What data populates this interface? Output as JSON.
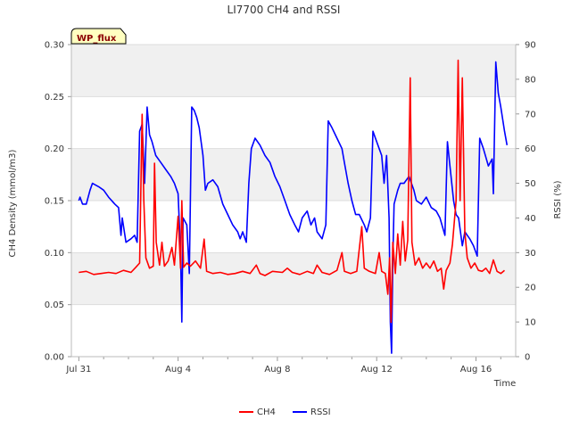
{
  "chart_data": {
    "type": "line",
    "title": "LI7700 CH4 and RSSI",
    "badge": "WP_flux",
    "xlabel": "Time",
    "ylabel_left": "CH4 Density (mmol/m3)",
    "ylabel_right": "RSSI (%)",
    "x_unit": "days since Jul 31",
    "xlim": [
      -0.3,
      17.6
    ],
    "ylim_left": [
      0,
      0.3
    ],
    "ylim_right": [
      0,
      90
    ],
    "x_ticks": [
      {
        "value": 0,
        "label": "Jul 31"
      },
      {
        "value": 4,
        "label": "Aug 4"
      },
      {
        "value": 8,
        "label": "Aug 8"
      },
      {
        "value": 12,
        "label": "Aug 12"
      },
      {
        "value": 16,
        "label": "Aug 16"
      }
    ],
    "y_left_ticks": [
      "0.00",
      "0.05",
      "0.10",
      "0.15",
      "0.20",
      "0.25",
      "0.30"
    ],
    "y_right_ticks": [
      "0",
      "10",
      "20",
      "30",
      "40",
      "50",
      "60",
      "70",
      "80",
      "90"
    ],
    "shaded_bands_left": [
      [
        0.05,
        0.1
      ],
      [
        0.15,
        0.2
      ],
      [
        0.25,
        0.3
      ]
    ],
    "grid": true,
    "legend_position": "bottom",
    "series": [
      {
        "name": "CH4",
        "axis": "left",
        "color": "#ff0000",
        "points": [
          [
            0.0,
            0.081
          ],
          [
            0.3,
            0.082
          ],
          [
            0.6,
            0.079
          ],
          [
            0.9,
            0.08
          ],
          [
            1.2,
            0.081
          ],
          [
            1.5,
            0.08
          ],
          [
            1.8,
            0.083
          ],
          [
            2.1,
            0.081
          ],
          [
            2.3,
            0.086
          ],
          [
            2.45,
            0.09
          ],
          [
            2.55,
            0.233
          ],
          [
            2.62,
            0.15
          ],
          [
            2.7,
            0.095
          ],
          [
            2.85,
            0.085
          ],
          [
            3.0,
            0.087
          ],
          [
            3.05,
            0.186
          ],
          [
            3.12,
            0.11
          ],
          [
            3.25,
            0.088
          ],
          [
            3.35,
            0.11
          ],
          [
            3.45,
            0.087
          ],
          [
            3.6,
            0.092
          ],
          [
            3.75,
            0.105
          ],
          [
            3.85,
            0.088
          ],
          [
            4.0,
            0.135
          ],
          [
            4.1,
            0.085
          ],
          [
            4.15,
            0.15
          ],
          [
            4.22,
            0.086
          ],
          [
            4.35,
            0.09
          ],
          [
            4.5,
            0.087
          ],
          [
            4.7,
            0.092
          ],
          [
            4.9,
            0.085
          ],
          [
            5.05,
            0.113
          ],
          [
            5.15,
            0.082
          ],
          [
            5.4,
            0.08
          ],
          [
            5.7,
            0.081
          ],
          [
            6.0,
            0.079
          ],
          [
            6.3,
            0.08
          ],
          [
            6.6,
            0.082
          ],
          [
            6.9,
            0.08
          ],
          [
            7.15,
            0.088
          ],
          [
            7.3,
            0.08
          ],
          [
            7.5,
            0.078
          ],
          [
            7.8,
            0.082
          ],
          [
            8.2,
            0.081
          ],
          [
            8.4,
            0.085
          ],
          [
            8.6,
            0.081
          ],
          [
            8.9,
            0.079
          ],
          [
            9.2,
            0.082
          ],
          [
            9.45,
            0.08
          ],
          [
            9.6,
            0.088
          ],
          [
            9.8,
            0.081
          ],
          [
            10.1,
            0.079
          ],
          [
            10.4,
            0.083
          ],
          [
            10.6,
            0.1
          ],
          [
            10.7,
            0.082
          ],
          [
            10.95,
            0.08
          ],
          [
            11.2,
            0.082
          ],
          [
            11.4,
            0.125
          ],
          [
            11.5,
            0.085
          ],
          [
            11.7,
            0.082
          ],
          [
            11.95,
            0.08
          ],
          [
            12.1,
            0.1
          ],
          [
            12.2,
            0.082
          ],
          [
            12.35,
            0.08
          ],
          [
            12.45,
            0.06
          ],
          [
            12.52,
            0.095
          ],
          [
            12.58,
            0.033
          ],
          [
            12.65,
            0.11
          ],
          [
            12.75,
            0.08
          ],
          [
            12.85,
            0.118
          ],
          [
            12.95,
            0.088
          ],
          [
            13.05,
            0.13
          ],
          [
            13.15,
            0.092
          ],
          [
            13.25,
            0.112
          ],
          [
            13.35,
            0.268
          ],
          [
            13.42,
            0.11
          ],
          [
            13.55,
            0.088
          ],
          [
            13.7,
            0.095
          ],
          [
            13.85,
            0.085
          ],
          [
            14.0,
            0.09
          ],
          [
            14.15,
            0.085
          ],
          [
            14.3,
            0.092
          ],
          [
            14.45,
            0.082
          ],
          [
            14.6,
            0.085
          ],
          [
            14.7,
            0.065
          ],
          [
            14.8,
            0.083
          ],
          [
            14.95,
            0.09
          ],
          [
            15.05,
            0.108
          ],
          [
            15.2,
            0.15
          ],
          [
            15.28,
            0.285
          ],
          [
            15.36,
            0.15
          ],
          [
            15.45,
            0.268
          ],
          [
            15.55,
            0.12
          ],
          [
            15.65,
            0.095
          ],
          [
            15.8,
            0.085
          ],
          [
            15.95,
            0.09
          ],
          [
            16.1,
            0.083
          ],
          [
            16.25,
            0.082
          ],
          [
            16.4,
            0.085
          ],
          [
            16.55,
            0.08
          ],
          [
            16.7,
            0.093
          ],
          [
            16.85,
            0.082
          ],
          [
            17.0,
            0.08
          ],
          [
            17.15,
            0.083
          ]
        ]
      },
      {
        "name": "RSSI",
        "axis": "right",
        "color": "#0000ff",
        "points": [
          [
            0.0,
            45
          ],
          [
            0.05,
            46
          ],
          [
            0.15,
            44
          ],
          [
            0.3,
            44
          ],
          [
            0.45,
            48
          ],
          [
            0.55,
            50
          ],
          [
            0.8,
            49
          ],
          [
            1.0,
            48
          ],
          [
            1.2,
            46
          ],
          [
            1.45,
            44
          ],
          [
            1.6,
            43
          ],
          [
            1.7,
            35
          ],
          [
            1.75,
            40
          ],
          [
            1.9,
            33
          ],
          [
            2.1,
            34
          ],
          [
            2.25,
            35
          ],
          [
            2.35,
            33
          ],
          [
            2.45,
            65
          ],
          [
            2.55,
            67
          ],
          [
            2.65,
            50
          ],
          [
            2.75,
            72
          ],
          [
            2.85,
            64
          ],
          [
            2.95,
            62
          ],
          [
            3.1,
            58
          ],
          [
            3.3,
            56
          ],
          [
            3.5,
            54
          ],
          [
            3.7,
            52
          ],
          [
            3.85,
            50
          ],
          [
            3.95,
            48
          ],
          [
            4.0,
            47
          ],
          [
            4.1,
            30
          ],
          [
            4.15,
            10
          ],
          [
            4.2,
            40
          ],
          [
            4.35,
            38
          ],
          [
            4.45,
            24
          ],
          [
            4.55,
            72
          ],
          [
            4.65,
            71
          ],
          [
            4.75,
            69
          ],
          [
            4.85,
            66
          ],
          [
            5.0,
            58
          ],
          [
            5.1,
            48
          ],
          [
            5.2,
            50
          ],
          [
            5.4,
            51
          ],
          [
            5.6,
            49
          ],
          [
            5.8,
            44
          ],
          [
            6.0,
            41
          ],
          [
            6.2,
            38
          ],
          [
            6.4,
            36
          ],
          [
            6.5,
            34
          ],
          [
            6.6,
            36
          ],
          [
            6.75,
            33
          ],
          [
            6.85,
            50
          ],
          [
            6.95,
            60
          ],
          [
            7.1,
            63
          ],
          [
            7.3,
            61
          ],
          [
            7.5,
            58
          ],
          [
            7.7,
            56
          ],
          [
            7.9,
            52
          ],
          [
            8.1,
            49
          ],
          [
            8.3,
            45
          ],
          [
            8.5,
            41
          ],
          [
            8.7,
            38
          ],
          [
            8.85,
            36
          ],
          [
            9.0,
            40
          ],
          [
            9.2,
            42
          ],
          [
            9.35,
            38
          ],
          [
            9.5,
            40
          ],
          [
            9.6,
            36
          ],
          [
            9.8,
            34
          ],
          [
            9.95,
            38
          ],
          [
            10.05,
            68
          ],
          [
            10.2,
            66
          ],
          [
            10.4,
            63
          ],
          [
            10.6,
            60
          ],
          [
            10.7,
            56
          ],
          [
            10.85,
            50
          ],
          [
            11.0,
            45
          ],
          [
            11.15,
            41
          ],
          [
            11.3,
            41
          ],
          [
            11.5,
            38
          ],
          [
            11.6,
            36
          ],
          [
            11.75,
            40
          ],
          [
            11.85,
            65
          ],
          [
            11.95,
            63
          ],
          [
            12.1,
            60
          ],
          [
            12.2,
            58
          ],
          [
            12.3,
            50
          ],
          [
            12.4,
            58
          ],
          [
            12.5,
            40
          ],
          [
            12.55,
            10
          ],
          [
            12.6,
            1
          ],
          [
            12.65,
            28
          ],
          [
            12.7,
            44
          ],
          [
            12.85,
            48
          ],
          [
            12.95,
            50
          ],
          [
            13.1,
            50
          ],
          [
            13.3,
            52
          ],
          [
            13.5,
            48
          ],
          [
            13.6,
            45
          ],
          [
            13.8,
            44
          ],
          [
            14.0,
            46
          ],
          [
            14.2,
            43
          ],
          [
            14.4,
            42
          ],
          [
            14.55,
            40
          ],
          [
            14.75,
            35
          ],
          [
            14.85,
            62
          ],
          [
            14.95,
            55
          ],
          [
            15.1,
            45
          ],
          [
            15.2,
            41
          ],
          [
            15.3,
            40
          ],
          [
            15.45,
            32
          ],
          [
            15.55,
            36
          ],
          [
            15.75,
            34
          ],
          [
            15.9,
            32
          ],
          [
            16.05,
            29
          ],
          [
            16.15,
            63
          ],
          [
            16.3,
            60
          ],
          [
            16.5,
            55
          ],
          [
            16.65,
            57
          ],
          [
            16.7,
            47
          ],
          [
            16.8,
            85
          ],
          [
            16.9,
            76
          ],
          [
            17.0,
            72
          ],
          [
            17.15,
            65
          ],
          [
            17.25,
            61
          ]
        ]
      }
    ]
  }
}
